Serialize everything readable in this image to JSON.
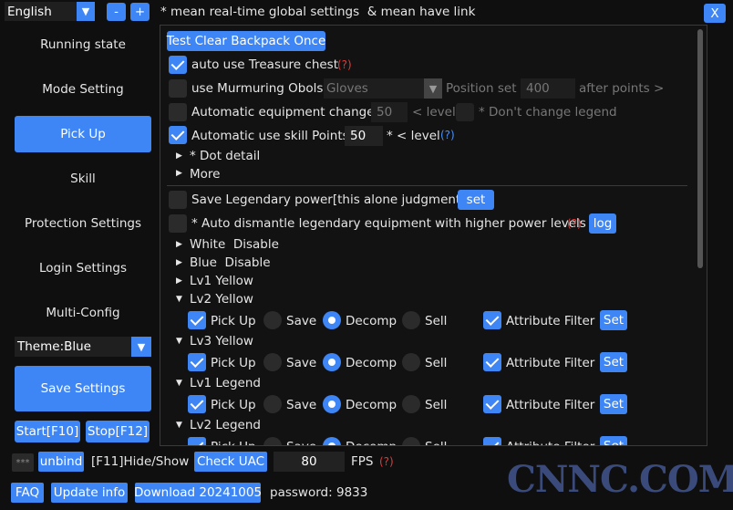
{
  "topbar": {
    "language": "English",
    "minus": "-",
    "plus": "+",
    "hint": "* mean real-time global settings  & mean have link",
    "close": "X"
  },
  "sidebar": {
    "items": [
      {
        "label": "Running state"
      },
      {
        "label": "Mode Setting"
      },
      {
        "label": "Pick Up"
      },
      {
        "label": "Skill"
      },
      {
        "label": "Protection Settings"
      },
      {
        "label": "Login Settings"
      },
      {
        "label": "Multi-Config"
      }
    ],
    "active_index": 2,
    "theme": "Theme:Blue",
    "save": "Save Settings",
    "start": "Start[F10]",
    "stop": "Stop[F12]"
  },
  "content": {
    "test_btn": "Test Clear Backpack Once",
    "treasure": {
      "label": "auto use Treasure chest",
      "q": "(?)",
      "checked": true
    },
    "obols": {
      "label": "use Murmuring Obols",
      "item": "Gloves",
      "pos_label": "Position set",
      "pos_value": "400",
      "after": "after points >",
      "checked": false
    },
    "equip": {
      "label": "Automatic equipment change",
      "value": "50",
      "lt_level": "< level",
      "legend_label": "* Don't change legend",
      "checked": false
    },
    "skill": {
      "label": "Automatic use skill Points",
      "value": "50",
      "lt_level": "* < level",
      "q": "(?)",
      "checked": true
    },
    "dot": "* Dot detail",
    "more": "More",
    "save_legendary": {
      "label": "Save Legendary power[this alone judgment]",
      "btn": "set",
      "checked": false
    },
    "dismantle": {
      "label": "* Auto dismantle legendary equipment with higher power levels",
      "q": "(?)",
      "btn": "log",
      "checked": false
    },
    "tiers": [
      {
        "label": "White  Disable",
        "expanded": false
      },
      {
        "label": "Blue  Disable",
        "expanded": false
      },
      {
        "label": "Lv1 Yellow",
        "expanded": false
      },
      {
        "label": "Lv2 Yellow",
        "expanded": true
      },
      {
        "label": "Lv3 Yellow",
        "expanded": true
      },
      {
        "label": "Lv1 Legend",
        "expanded": true
      },
      {
        "label": "Lv2 Legend",
        "expanded": true
      }
    ],
    "row_labels": {
      "pickup": "Pick Up",
      "save": "Save",
      "decomp": "Decomp",
      "sell": "Sell",
      "attr": "Attribute Filter",
      "set": "Set"
    }
  },
  "bottombar": {
    "stars": "***",
    "unbind": "unbind",
    "hide": "[F11]Hide/Show",
    "uac": "Check UAC",
    "fps_value": "80",
    "fps": "FPS",
    "q": "(?)",
    "faq": "FAQ",
    "update": "Update info",
    "download": "Download 20241005",
    "password_label": "password:",
    "password": "9833"
  },
  "watermark": "CNNC.COM",
  "colors": {
    "accent": "#3e86f5",
    "background": "#0f0f0f",
    "help": "#e03a3a"
  }
}
